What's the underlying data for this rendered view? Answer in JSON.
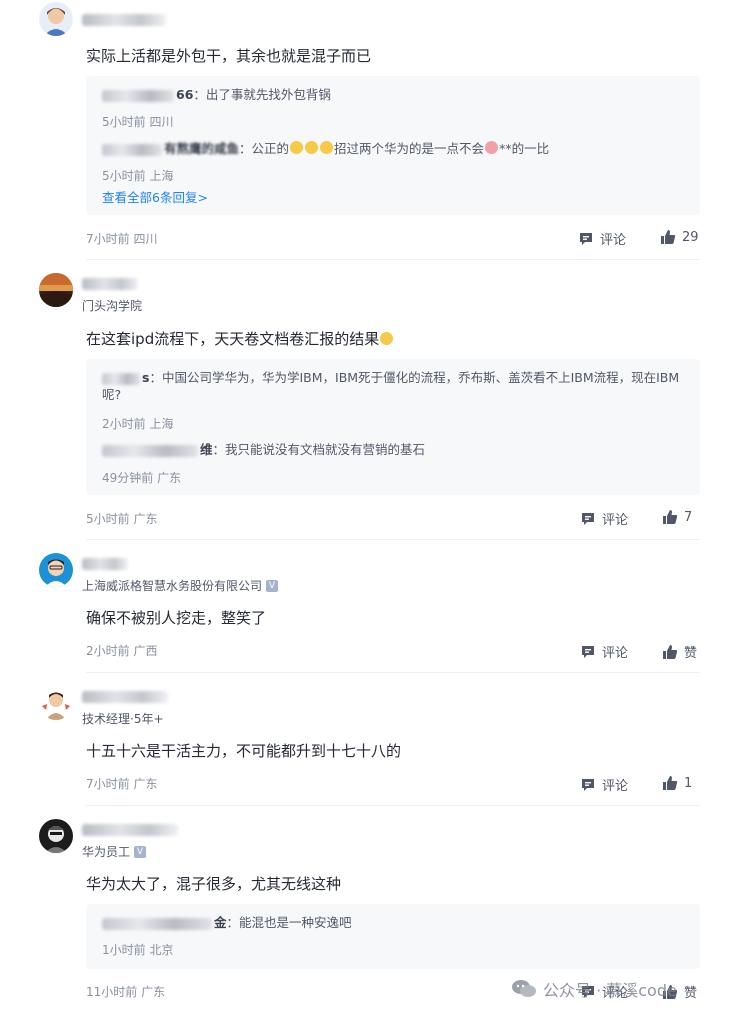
{
  "comments": [
    {
      "author": "搬砖搬砖666",
      "content": "实际上活都是外包干，其余也就是混子而已",
      "replies": [
        {
          "name_tail": "66",
          "text": "出了事就先找外包背锅",
          "meta": "5小时前 四川"
        },
        {
          "name_tail": "有熬鹰的咸鱼",
          "text_before": "公正的",
          "text_after": "招过两个华为的是一点不会",
          "text_end": "**的一比",
          "meta": "5小时前 上海"
        }
      ],
      "see_all": "查看全部6条回复>",
      "meta": "7小时前 四川",
      "comment_label": "评论",
      "like_label": "29"
    },
    {
      "author": "",
      "title": "门头沟学院",
      "content": "在这套ipd流程下，天天卷文档卷汇报的结果",
      "replies": [
        {
          "name_tail": "s",
          "text": "中国公司学华为，华为学IBM，IBM死于僵化的流程，乔布斯、盖茨看不上IBM流程，现在IBM呢?",
          "meta": "2小时前 上海"
        },
        {
          "name_tail": "维",
          "text": "我只能说没有文档就没有营销的基石",
          "meta": "49分钟前 广东"
        }
      ],
      "meta": "5小时前 广东",
      "comment_label": "评论",
      "like_label": "7"
    },
    {
      "title": "上海威派格智慧水务股份有限公司",
      "verified": "V",
      "content": "确保不被别人挖走，整笑了",
      "meta": "2小时前 广西",
      "comment_label": "评论",
      "like_label": "赞"
    },
    {
      "title": "技术经理·5年+",
      "content": "十五十六是干活主力，不可能都升到十七十八的",
      "meta": "7小时前 广东",
      "comment_label": "评论",
      "like_label": "1"
    },
    {
      "title": "华为员工",
      "verified": "V",
      "content": "华为太大了，混子很多，尤其无线这种",
      "replies": [
        {
          "name_tail": "金",
          "text": "能混也是一种安逸吧",
          "meta": "1小时前 北京"
        }
      ],
      "meta": "11小时前 广东",
      "comment_label": "评论",
      "like_label": "赞"
    }
  ],
  "watermark": "公众号 · 慕溪code",
  "colors": {
    "link": "#1e80ff",
    "meta": "#8a919f",
    "reply_bg": "#f7f8fa"
  }
}
